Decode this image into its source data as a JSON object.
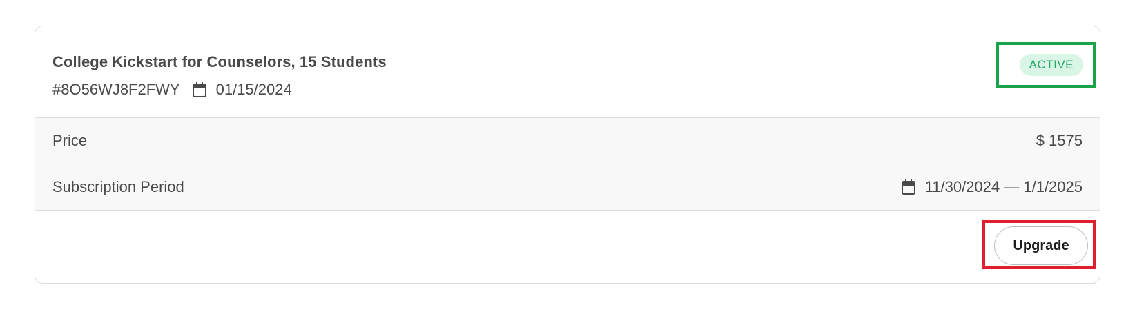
{
  "subscription": {
    "title": "College Kickstart for Counselors, 15 Students",
    "order_id": "#8O56WJ8F2FWY",
    "order_date": "01/15/2024",
    "status": "ACTIVE",
    "colors": {
      "status_text": "#25a86a",
      "status_bg": "#d9f5e6",
      "status_highlight": "#1aa34a",
      "upgrade_highlight": "#e01e2f"
    }
  },
  "details": {
    "price_label": "Price",
    "price_value": "$ 1575",
    "period_label": "Subscription Period",
    "period_value": "11/30/2024 — 1/1/2025"
  },
  "actions": {
    "upgrade_label": "Upgrade"
  },
  "icons": {
    "date_icon": "calendar-icon"
  }
}
